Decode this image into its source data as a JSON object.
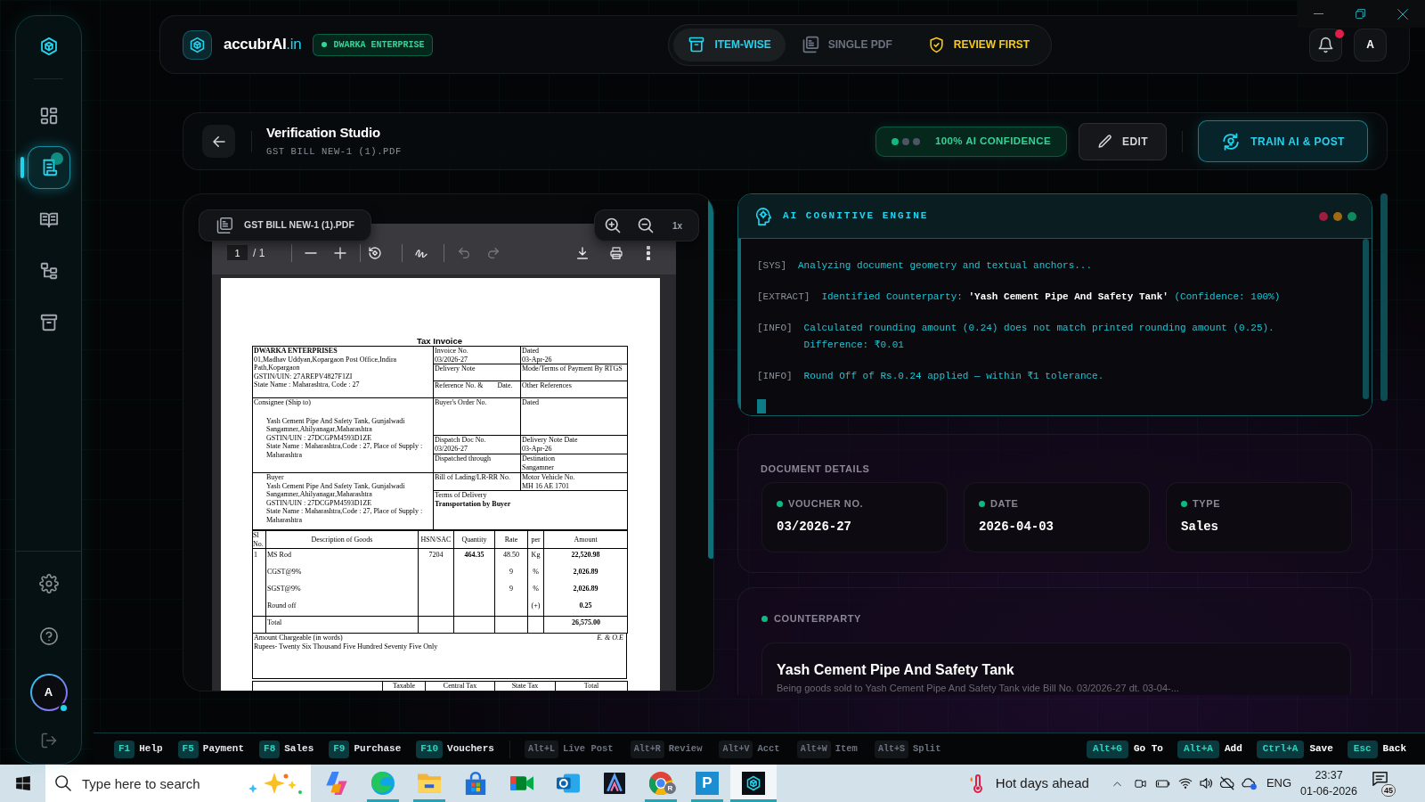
{
  "sidebar": {
    "nav": [
      {
        "selected": false,
        "dot": false
      },
      {
        "selected": true,
        "dot": true
      },
      {
        "selected": false,
        "dot": false
      },
      {
        "selected": false,
        "dot": false
      },
      {
        "selected": false,
        "dot": false
      }
    ],
    "user": {
      "initial": "A",
      "online": true
    }
  },
  "header": {
    "brand": {
      "name": "accubrAI",
      "domain": ".in"
    },
    "company": "DWARKA ENTERPRISE",
    "modes": [
      {
        "label": "ITEM-WISE",
        "selected": true
      },
      {
        "label": "SINGLE PDF",
        "selected": false
      }
    ],
    "review_first": {
      "label": "REVIEW FIRST",
      "on": true
    },
    "notifications": {
      "unread": true
    },
    "user_initial": "A"
  },
  "studio": {
    "title": "Verification Studio",
    "file": "GST BILL NEW-1 (1).PDF",
    "confidence": {
      "label": "100% AI CONFIDENCE",
      "dots": [
        {
          "on": true
        },
        {
          "on": false
        },
        {
          "on": false
        }
      ]
    },
    "actions": [
      {
        "kind": "secondary",
        "label": "EDIT"
      },
      {
        "kind": "primary",
        "label": "TRAIN AI & POST"
      }
    ]
  },
  "pdf_viewer": {
    "file_name": "GST BILL NEW-1 (1).PDF",
    "zoom": "1x",
    "page": "1",
    "page_total": "/ 1",
    "undo": {
      "disabled": true
    },
    "redo": {
      "disabled": true
    },
    "invoice": {
      "title": "Tax Invoice",
      "seller": {
        "name": "DWARKA ENTERPRISES",
        "lines": [
          "01,Madhav Uddyan,Kopargaon Post Office,Indira",
          "Path,Kopargaon",
          "GSTIN/UIN: 27AREPV4827F1ZI",
          "State Name : Maharashtra, Code : 27"
        ]
      },
      "details": [
        [
          {
            "label": "Invoice No.",
            "value": "03/2026-27"
          },
          {
            "label": "Dated",
            "value": "03-Apr-26"
          }
        ],
        [
          {
            "label": "Delivery Note"
          },
          {
            "label": "Mode/Terms of Payment By RTGS"
          }
        ],
        [
          {
            "label": "Reference No. &",
            "aside": "Date."
          },
          {
            "label": "Other References"
          }
        ],
        [
          {
            "label": "Buyer's Order No."
          },
          {
            "label": "Dated"
          }
        ],
        [
          {
            "label": "Dispatch Doc No.",
            "value": "03/2026-27"
          },
          {
            "label": "Delivery Note Date",
            "value": "03-Apr-26"
          }
        ],
        [
          {
            "label": "Dispatched through"
          },
          {
            "label": "Destination",
            "value": "Sangamner"
          }
        ],
        [
          {
            "label": "Bill of Lading/LR-RR No."
          },
          {
            "label": "Motor Vehicle No.",
            "value": "MH 16 AE 1701"
          }
        ]
      ],
      "terms": {
        "label": "Terms of Delivery",
        "value": "Transportation by Buyer"
      },
      "consignee": {
        "label": "Consignee (Ship to)",
        "lines": [
          "Yash Cement Pipe And Safety Tank, Gunjalwadi",
          "Sangamner,Ahilyanagar,Maharashtra",
          "GSTIN/UIN : 27DCGPM4593D1ZE",
          "State Name : Maharashtra,Code : 27, Place of Supply :",
          "Maharashtra"
        ]
      },
      "buyer": {
        "label": "Buyer",
        "lines": [
          "Yash Cement Pipe And Safety Tank, Gunjalwadi",
          "Sangamner,Ahilyanagar,Maharashtra",
          "GSTIN/UIN : 27DCGPM4593D1ZE",
          "State Name : Maharashtra,Code : 27, Place of Supply :",
          "Maharashtra"
        ]
      },
      "items": {
        "columns": [
          "Sl No.",
          "Description of Goods",
          "HSN/SAC",
          "Quantity",
          "Rate",
          "per",
          "Amount"
        ],
        "rows": [
          {
            "sl": "1",
            "description": "MS Rod",
            "hsn": "7204",
            "quantity": "464.35",
            "rate": "48.50",
            "per": "Kg",
            "amount": "22,520.98"
          },
          {
            "description": "CGST@9%",
            "rate": "9",
            "per": "%",
            "amount": "2,026.89"
          },
          {
            "description": "SGST@9%",
            "rate": "9",
            "per": "%",
            "amount": "2,026.89"
          },
          {
            "description": "Round off",
            "per": "(+)",
            "amount": "0.25"
          }
        ],
        "total": {
          "label": "Total",
          "amount": "26,575.00"
        }
      },
      "amount_in_words": {
        "label": "Amount Chargeable (in words)",
        "value": "Rupees- Twenty Six Thousand Five Hundred Seventy Five Only",
        "note": "E. & O.E"
      },
      "tax_columns": [
        "Taxable",
        "Central Tax",
        "State Tax",
        "Total"
      ]
    }
  },
  "engine": {
    "title": "AI COGNITIVE ENGINE",
    "log": [
      {
        "tag": "[SYS]",
        "text": "Analyzing document geometry and textual anchors..."
      },
      {
        "tag": "[EXTRACT]",
        "text": "Identified Counterparty: **'Yash Cement Pipe And Safety Tank'** (Confidence: 100%)"
      },
      {
        "tag": "[INFO]",
        "text": "Calculated rounding amount (0.24) does not match printed rounding amount (0.25). Difference: ₹0.01"
      },
      {
        "tag": "[INFO]",
        "text": "Round Off of Rs.0.24 applied — within ₹1 tolerance."
      }
    ]
  },
  "document_details": {
    "title": "DOCUMENT DETAILS",
    "fields": [
      {
        "label": "VOUCHER NO.",
        "value": "03/2026-27"
      },
      {
        "label": "DATE",
        "value": "2026-04-03"
      },
      {
        "label": "TYPE",
        "value": "Sales"
      }
    ]
  },
  "counterparty": {
    "title": "COUNTERPARTY",
    "name": "Yash Cement Pipe And Safety Tank",
    "narration": "Being goods sold to Yash Cement Pipe And Safety Tank vide Bill No. 03/2026-27 dt. 03-04-..."
  },
  "shortcuts": {
    "main": [
      {
        "key": "F1",
        "label": "Help"
      },
      {
        "key": "F5",
        "label": "Payment"
      },
      {
        "key": "F8",
        "label": "Sales"
      },
      {
        "key": "F9",
        "label": "Purchase"
      },
      {
        "key": "F10",
        "label": "Vouchers"
      }
    ],
    "secondary": [
      {
        "key": "Alt+L",
        "label": "Live Post"
      },
      {
        "key": "Alt+R",
        "label": "Review"
      },
      {
        "key": "Alt+V",
        "label": "Acct"
      },
      {
        "key": "Alt+W",
        "label": "Item"
      },
      {
        "key": "Alt+S",
        "label": "Split"
      }
    ],
    "navigation": [
      {
        "key": "Alt+G",
        "label": "Go To"
      },
      {
        "key": "Alt+A",
        "label": "Add"
      },
      {
        "key": "Ctrl+A",
        "label": "Save"
      },
      {
        "key": "Esc",
        "label": "Back"
      }
    ]
  },
  "taskbar": {
    "search": {
      "placeholder": "Type here to search"
    },
    "apps": [
      {
        "running": false,
        "active": false
      },
      {
        "running": true,
        "active": false
      },
      {
        "running": true,
        "active": false
      },
      {
        "running": false,
        "active": false
      },
      {
        "running": false,
        "active": false
      },
      {
        "running": false,
        "active": false
      },
      {
        "running": false,
        "active": false
      },
      {
        "running": true,
        "active": false,
        "badge": "R"
      },
      {
        "running": true,
        "active": false,
        "letter": "P"
      },
      {
        "running": true,
        "active": true
      }
    ],
    "weather": "Hot days ahead",
    "language": "ENG",
    "time": "23:37",
    "date": "01-06-2026",
    "notification_count": "45"
  }
}
